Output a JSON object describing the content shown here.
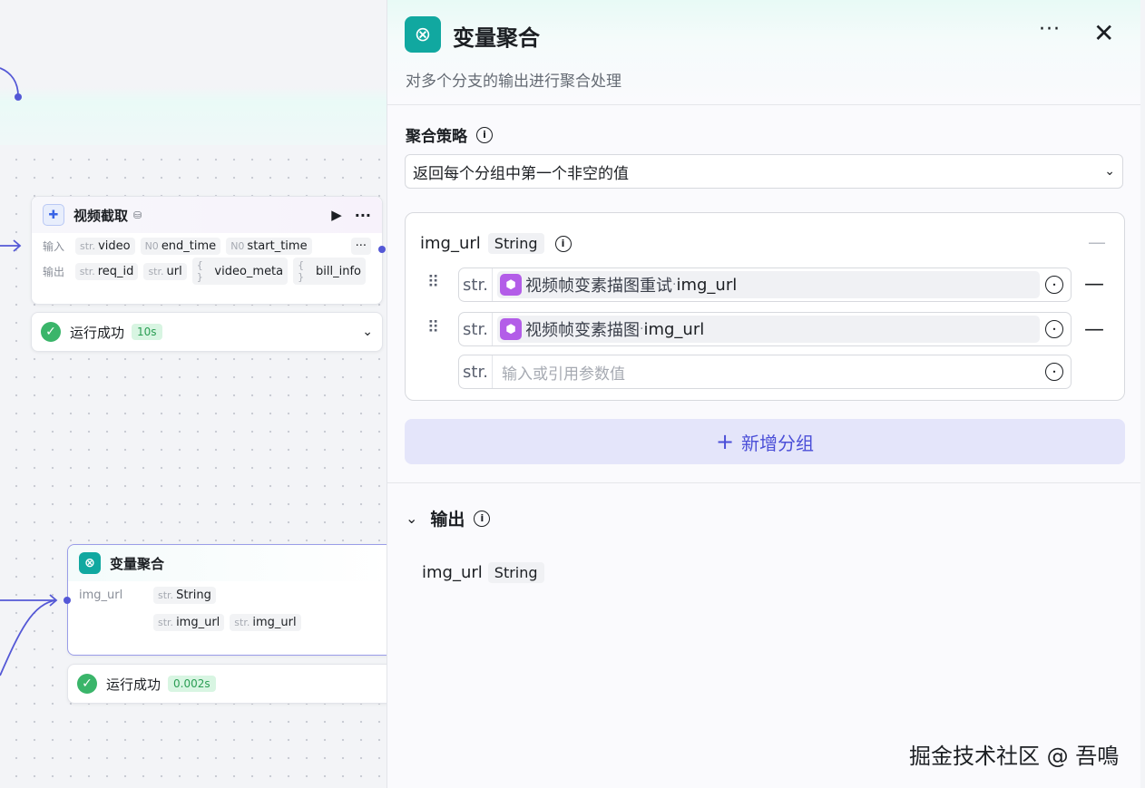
{
  "colors": {
    "accent": "#4b4fd8",
    "teal": "#11a8a0",
    "success": "#3ab56a",
    "purple": "#b35de8"
  },
  "nodes": {
    "video": {
      "title": "视频截取",
      "inputs_label": "输入",
      "outputs_label": "输出",
      "inputs": [
        {
          "type": "str.",
          "name": "video"
        },
        {
          "type": "N0",
          "name": "end_time"
        },
        {
          "type": "N0",
          "name": "start_time"
        }
      ],
      "outputs": [
        {
          "type": "str.",
          "name": "req_id"
        },
        {
          "type": "str.",
          "name": "url"
        },
        {
          "type": "{ }",
          "name": "video_meta"
        },
        {
          "type": "{ }",
          "name": "bill_info"
        }
      ],
      "more": "···",
      "status": "运行成功",
      "duration": "10s"
    },
    "aggregate": {
      "title": "变量聚合",
      "field": "img_url",
      "type_tag": {
        "type": "str.",
        "name": "String"
      },
      "refs": [
        {
          "type": "str.",
          "name": "img_url"
        },
        {
          "type": "str.",
          "name": "img_url"
        }
      ],
      "status": "运行成功",
      "duration": "0.002s"
    }
  },
  "panel": {
    "title": "变量聚合",
    "description": "对多个分支的输出进行聚合处理",
    "more": "···",
    "close": "✕",
    "strategy_label": "聚合策略",
    "strategy_value": "返回每个分组中第一个非空的值",
    "group": {
      "name": "img_url",
      "type": "String",
      "rows": [
        {
          "type": "str.",
          "source": "视频帧变素描图重试",
          "sep": " · ",
          "var": "img_url"
        },
        {
          "type": "str.",
          "source": "视频帧变素描图",
          "sep": " · ",
          "var": "img_url"
        }
      ],
      "empty_type": "str.",
      "placeholder": "输入或引用参数值"
    },
    "add_group": "新增分组",
    "output_label": "输出",
    "output": {
      "name": "img_url",
      "type": "String"
    }
  },
  "watermark": "掘金技术社区 @ 吾鳴"
}
